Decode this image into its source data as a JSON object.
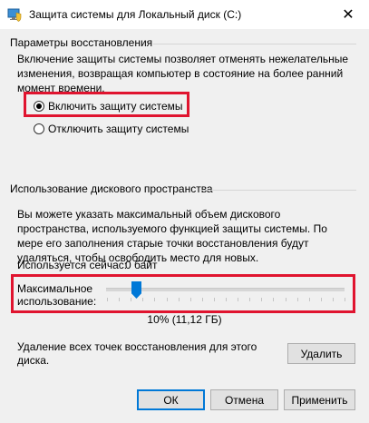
{
  "window": {
    "title": "Защита системы для Локальный диск (C:)",
    "close_symbol": "✕"
  },
  "restore": {
    "header": "Параметры восстановления",
    "description": "Включение защиты системы позволяет отменять нежелательные изменения, возвращая компьютер в состояние на более ранний момент времени.",
    "options": [
      {
        "label": "Включить защиту системы",
        "checked": true
      },
      {
        "label": "Отключить защиту системы",
        "checked": false
      }
    ]
  },
  "disk": {
    "header": "Использование дискового пространства",
    "description": "Вы можете указать максимальный объем дискового пространства, используемого функцией защиты системы. По мере его заполнения старые точки восстановления будут удаляться, чтобы освободить место для новых.",
    "current_label": "Используется сейчас:",
    "current_value": "0 байт",
    "max_label_line1": "Максимальное",
    "max_label_line2": "использование:",
    "slider_percent": 10,
    "slider_value_text": "10% (11,12 ГБ)",
    "delete_text_line1": "Удаление всех точек восстановления для этого",
    "delete_text_line2": "диска.",
    "delete_button": "Удалить"
  },
  "footer": {
    "ok": "ОК",
    "cancel": "Отмена",
    "apply": "Применить"
  },
  "colors": {
    "highlight": "#e0142f",
    "accent": "#0078d7"
  }
}
